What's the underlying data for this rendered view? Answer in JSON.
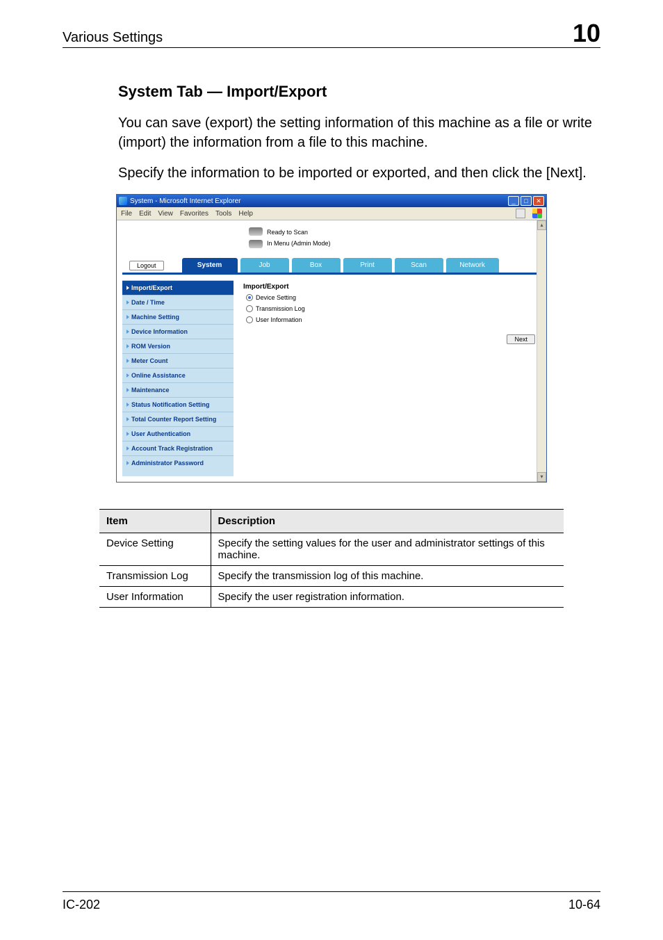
{
  "header": {
    "left": "Various Settings",
    "right": "10"
  },
  "section_title": "System Tab — Import/Export",
  "paragraphs": [
    "You can save (export) the setting information of this machine as a file or write (import) the information from a file to this machine.",
    "Specify the information to be imported or exported, and then click the [Next]."
  ],
  "browser": {
    "title": "System - Microsoft Internet Explorer",
    "menus": [
      "File",
      "Edit",
      "View",
      "Favorites",
      "Tools",
      "Help"
    ],
    "winbtns": {
      "min": "_",
      "max": "□",
      "close": "✕"
    },
    "status_top": "Ready to Scan",
    "status_bottom": "In Menu (Admin Mode)",
    "logout": "Logout",
    "tabs": [
      "System",
      "Job",
      "Box",
      "Print",
      "Scan",
      "Network"
    ],
    "sidebar": [
      "Import/Export",
      "Date / Time",
      "Machine Setting",
      "Device Information",
      "ROM Version",
      "Meter Count",
      "Online Assistance",
      "Maintenance",
      "Status Notification Setting",
      "Total Counter Report Setting",
      "User Authentication",
      "Account Track Registration",
      "Administrator Password"
    ],
    "pane_title": "Import/Export",
    "radios": [
      {
        "label": "Device Setting",
        "checked": true
      },
      {
        "label": "Transmission Log",
        "checked": false
      },
      {
        "label": "User Information",
        "checked": false
      }
    ],
    "next_label": "Next"
  },
  "table": {
    "head_item": "Item",
    "head_desc": "Description",
    "rows": [
      {
        "item": "Device Setting",
        "desc": "Specify the setting values for the user and administrator settings of this machine."
      },
      {
        "item": "Transmission Log",
        "desc": "Specify the transmission log of this machine."
      },
      {
        "item": "User Information",
        "desc": "Specify the user registration information."
      }
    ]
  },
  "footer": {
    "left": "IC-202",
    "right": "10-64"
  }
}
